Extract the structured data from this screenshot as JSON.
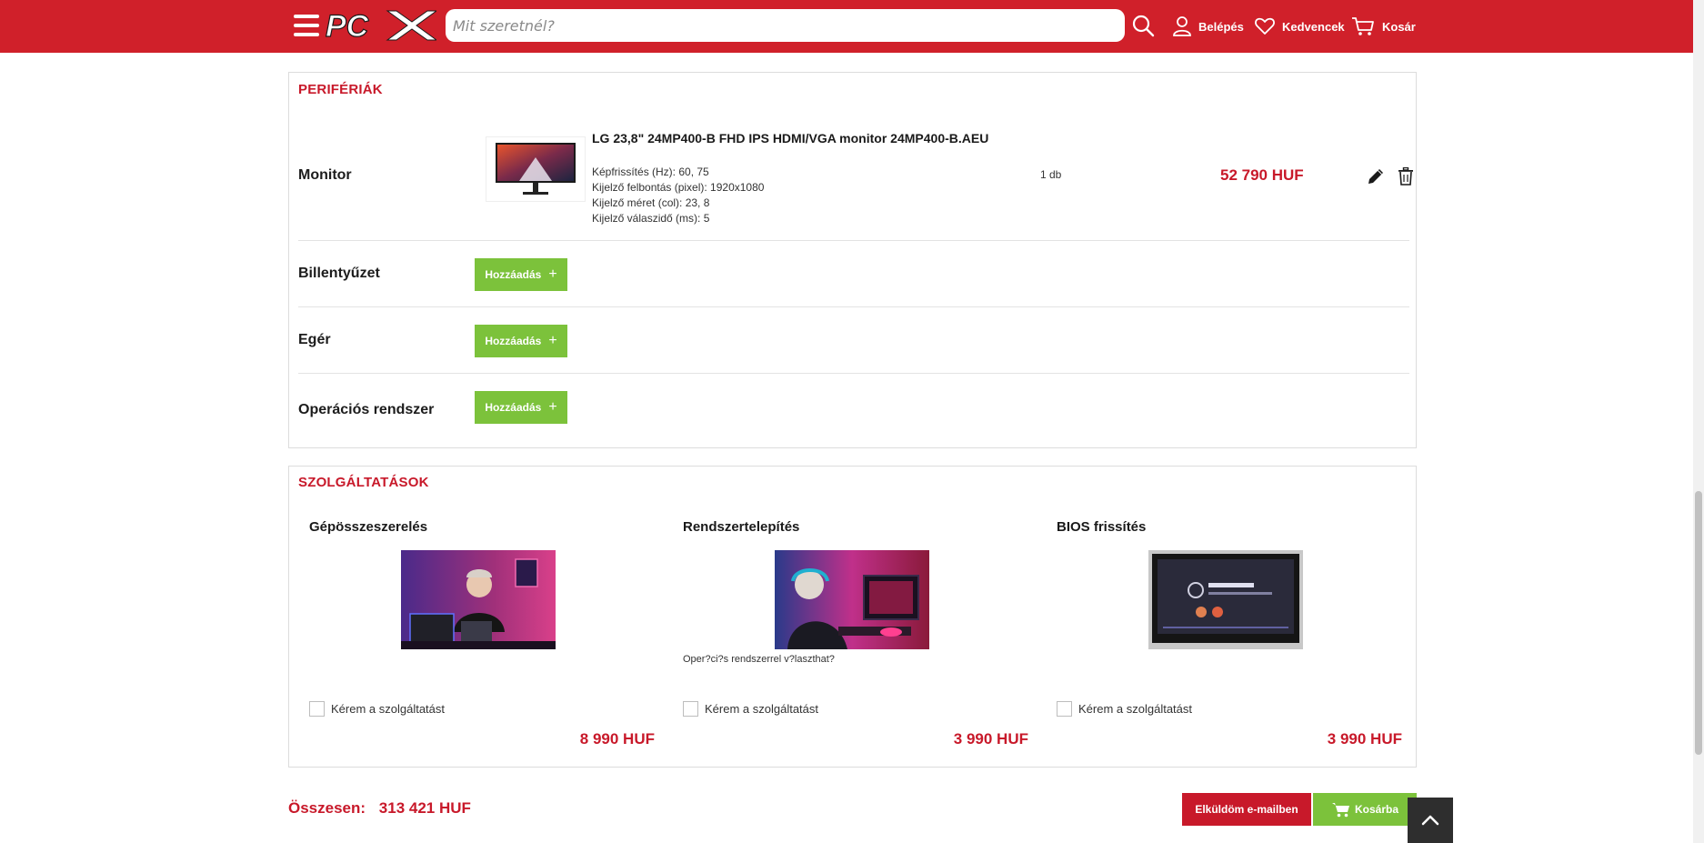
{
  "header": {
    "search_placeholder": "Mit szeretnél?",
    "login_label": "Belépés",
    "favorites_label": "Kedvencek",
    "cart_label": "Kosár"
  },
  "peripherals": {
    "title": "PERIFÉRIÁK",
    "monitor": {
      "label": "Monitor",
      "product_title": "LG 23,8\" 24MP400-B FHD IPS HDMI/VGA monitor 24MP400-B.AEU",
      "specs": [
        "Képfrissítés (Hz): 60, 75",
        "Kijelző felbontás (pixel): 1920x1080",
        "Kijelző méret (col): 23, 8",
        "Kijelző válaszidő (ms): 5"
      ],
      "quantity": "1 db",
      "price": "52 790 HUF"
    },
    "keyboard_label": "Billentyűzet",
    "mouse_label": "Egér",
    "os_label": "Operációs rendszer",
    "add_label": "Hozzáadás"
  },
  "services": {
    "title": "SZOLGÁLTATÁSOK",
    "checkbox_label": "Kérem a szolgáltatást",
    "items": [
      {
        "title": "Gépösszeszerelés",
        "price": "8 990 HUF",
        "note": ""
      },
      {
        "title": "Rendszertelepítés",
        "price": "3 990 HUF",
        "note": "Oper?ci?s rendszerrel v?laszthat?"
      },
      {
        "title": "BIOS frissítés",
        "price": "3 990 HUF",
        "note": ""
      }
    ]
  },
  "footer": {
    "total_label": "Összesen:",
    "total_value": "313 421 HUF",
    "email_label": "Elküldöm e-mailben",
    "cart_button_label": "Kosárba"
  },
  "colors": {
    "brand_red": "#d0202a",
    "accent_green": "#7cc23b",
    "price_red": "#c8192a"
  }
}
